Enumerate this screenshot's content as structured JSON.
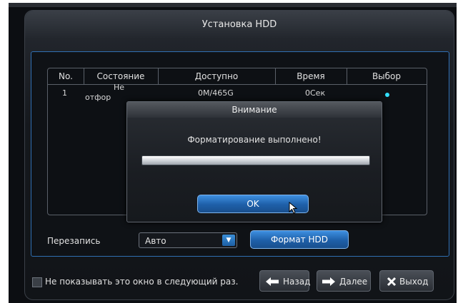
{
  "window": {
    "title": "Установка HDD"
  },
  "table": {
    "headers": [
      "No.",
      "Состояние",
      "Доступно",
      "Время",
      "Выбор"
    ],
    "row": {
      "no": "1",
      "status_line1": "Не",
      "status_line2": "отфор",
      "available": "0M/465G",
      "time": "0Сек"
    }
  },
  "overwrite": {
    "label": "Перезапись",
    "value": "Авто"
  },
  "format_button": "Формат HDD",
  "dialog": {
    "title": "Внимание",
    "message": "Форматирование выполнено!",
    "progress": 1.0,
    "ok_label": "OK"
  },
  "footer": {
    "checkbox_label": "Не показывать это окно в следующий раз.",
    "back_label": "Назад",
    "next_label": "Далее",
    "exit_label": "Выход"
  },
  "icons": [
    "chevron-down-icon",
    "arrow-left-icon",
    "arrow-right-icon",
    "close-icon",
    "mouse-cursor-icon"
  ],
  "colors": {
    "accent": "#3d8fe0",
    "selection_dot": "#33e0ff"
  }
}
